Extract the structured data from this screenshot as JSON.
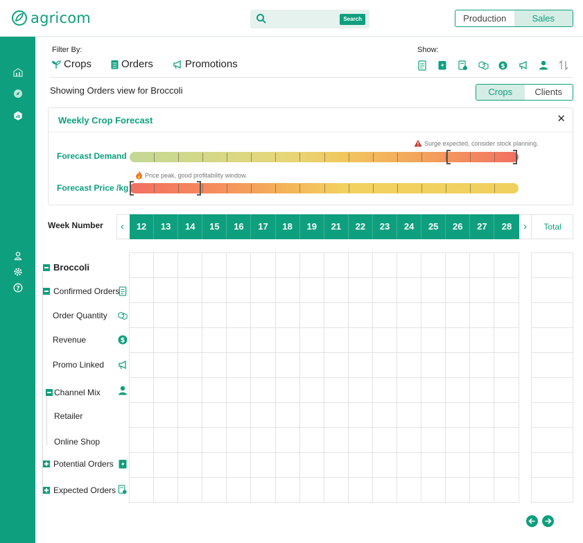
{
  "app": {
    "name": "agricom"
  },
  "search": {
    "placeholder": "",
    "button_label": "Search"
  },
  "mode_toggle": {
    "options": [
      "Production",
      "Sales"
    ],
    "active": "Sales"
  },
  "sidebar": {
    "top_icons": [
      "warehouse-icon",
      "compass-icon",
      "chart-icon"
    ],
    "bottom_icons": [
      "user-icon",
      "settings-icon",
      "help-icon"
    ]
  },
  "filter": {
    "label": "Filter By:",
    "items": [
      {
        "label": "Crops",
        "icon": "sprout-icon"
      },
      {
        "label": "Orders",
        "icon": "clipboard-icon"
      },
      {
        "label": "Promotions",
        "icon": "megaphone-icon"
      }
    ]
  },
  "show": {
    "label": "Show:",
    "icons": [
      "confirmed-orders-icon",
      "potential-orders-icon",
      "expected-orders-icon",
      "order-quantity-icon",
      "revenue-icon",
      "promo-icon",
      "channel-icon",
      "sort-icon"
    ]
  },
  "view": {
    "text": "Showing Orders view for Broccoli",
    "toggle": [
      "Crops",
      "Clients"
    ],
    "active": "Crops"
  },
  "forecast": {
    "title": "Weekly Crop Forecast",
    "demand_label": "Forecast Demand",
    "price_label": "Forecast Price /kg",
    "demand_note": "Surge expected, consider stock planning.",
    "price_note": "Price peak, good profitability window.",
    "colors": {
      "low": "#c3d896",
      "mid": "#f2d161",
      "high": "#f26f62"
    }
  },
  "weeks": {
    "label": "Week Number",
    "numbers": [
      "12",
      "13",
      "14",
      "15",
      "16",
      "17",
      "18",
      "19",
      "21",
      "22",
      "23",
      "24",
      "25",
      "26",
      "27",
      "28"
    ],
    "total_label": "Total"
  },
  "tree": {
    "crop": "Broccoli",
    "confirmed_orders": "Confirmed Orders",
    "order_quantity": "Order Quantity",
    "revenue": "Revenue",
    "promo_linked": "Promo Linked",
    "channel_mix": "Channel Mix",
    "retailer": "Retailer",
    "online_shop": "Online Shop",
    "potential_orders": "Potential Orders",
    "expected_orders": "Expected Orders"
  },
  "colors": {
    "accent": "#0e9f7e",
    "accent_light": "#d6ede5"
  }
}
